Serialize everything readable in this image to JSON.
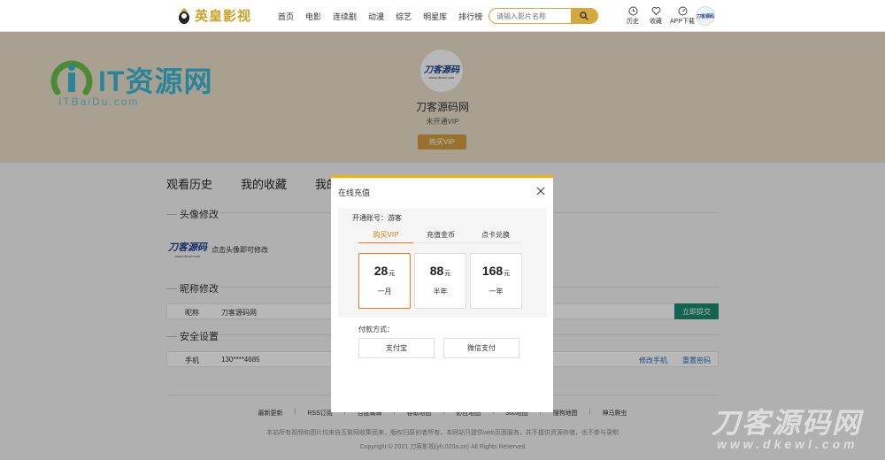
{
  "topbar": {
    "logo_text": "英皇影视",
    "nav": [
      "首页",
      "电影",
      "连续剧",
      "动漫",
      "综艺",
      "明星库",
      "排行榜"
    ],
    "search_placeholder": "请输入影片名称",
    "icons": [
      {
        "name": "history",
        "label": "历史"
      },
      {
        "name": "favorite",
        "label": "收藏"
      },
      {
        "name": "app-download",
        "label": "APP下载"
      }
    ],
    "avatar_text": "刀客源码"
  },
  "banner": {
    "watermark_logo": "IT资源网",
    "watermark_sub": "ITBaiDu.com",
    "avatar_main": "刀客源码",
    "avatar_sub": "www.dkewl.com",
    "username": "刀客源码网",
    "vip_status": "未开通VIP",
    "buy_vip": "购买VIP"
  },
  "tabs": [
    "观看历史",
    "我的收藏",
    "我的"
  ],
  "sections": {
    "avatar_title": "头像修改",
    "avatar_main": "刀客源码",
    "avatar_sub": "www.dkewl.com",
    "avatar_hint": "点击头像即可修改",
    "nickname_title": "昵称修改",
    "nickname_key": "昵称",
    "nickname_value": "刀客源码网",
    "submit": "立即提交",
    "security_title": "安全设置",
    "phone_key": "手机",
    "phone_value": "130****4685",
    "change_phone": "修改手机",
    "reset_password": "重置密码"
  },
  "footer": {
    "links": [
      "最新更新",
      "RSS订阅",
      "百度蜘蛛",
      "谷歌地图",
      "必应地图",
      "360地图",
      "搜狗地图",
      "神马爬虫"
    ],
    "disclaimer": "本站所有视频和图片均来自互联网收集而来，版权归原创者所有，本网站只提供web页面服务，并不提供资源存储，也不参与录制",
    "copyright": "Copyright © 2021 刀客影视(yh.020a.cn) All Rights Reserved"
  },
  "watermark": {
    "main": "刀客源码网",
    "sub": "www.dkewl.com"
  },
  "modal": {
    "title": "在线充值",
    "account_label": "开通账号：游客",
    "tabs": [
      "购买VIP",
      "充值金币",
      "点卡兑换"
    ],
    "active_tab": 0,
    "plans": [
      {
        "price": "28",
        "unit": "元",
        "duration": "一月"
      },
      {
        "price": "88",
        "unit": "元",
        "duration": "半年"
      },
      {
        "price": "168",
        "unit": "元",
        "duration": "一年"
      }
    ],
    "selected_plan": 0,
    "pay_label": "付款方式：",
    "pay_methods": [
      "支付宝",
      "微信支付"
    ]
  },
  "colors": {
    "accent": "#d4a83a",
    "modal_top": "#f0b400",
    "active_orange": "#e47b1e",
    "submit_green": "#1a8a6e",
    "link_blue": "#2a6ab0"
  }
}
